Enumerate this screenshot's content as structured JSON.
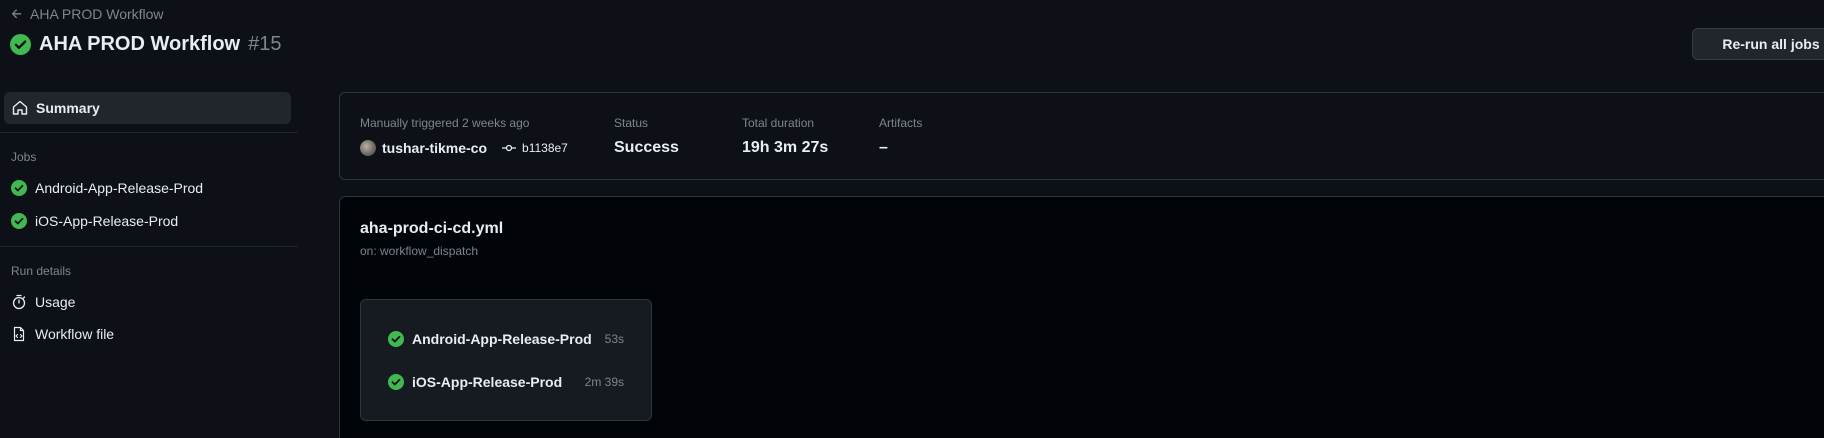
{
  "header": {
    "back_label": "AHA PROD Workflow",
    "title": "AHA PROD Workflow",
    "run_number": "#15",
    "rerun_label": "Re-run all jobs"
  },
  "sidebar": {
    "summary_label": "Summary",
    "jobs_heading": "Jobs",
    "jobs": [
      {
        "label": "Android-App-Release-Prod",
        "icon": "success-check-icon"
      },
      {
        "label": "iOS-App-Release-Prod",
        "icon": "success-check-icon"
      }
    ],
    "run_details_heading": "Run details",
    "run_details": [
      {
        "label": "Usage",
        "icon": "stopwatch-icon"
      },
      {
        "label": "Workflow file",
        "icon": "file-code-icon"
      }
    ]
  },
  "summary": {
    "trigger_text": "Manually triggered 2 weeks ago",
    "actor": "tushar-tikme-co",
    "commit": "b1138e7",
    "status_label": "Status",
    "status_value": "Success",
    "duration_label": "Total duration",
    "duration_value": "19h 3m 27s",
    "artifacts_label": "Artifacts",
    "artifacts_value": "–"
  },
  "workflow": {
    "file_name": "aha-prod-ci-cd.yml",
    "trigger": "on: workflow_dispatch",
    "jobs": [
      {
        "name": "Android-App-Release-Prod",
        "duration": "53s"
      },
      {
        "name": "iOS-App-Release-Prod",
        "duration": "2m 39s"
      }
    ]
  },
  "colors": {
    "background": "#0d1117",
    "success": "#3fb950",
    "muted": "#7d8590",
    "border": "#30363d"
  }
}
